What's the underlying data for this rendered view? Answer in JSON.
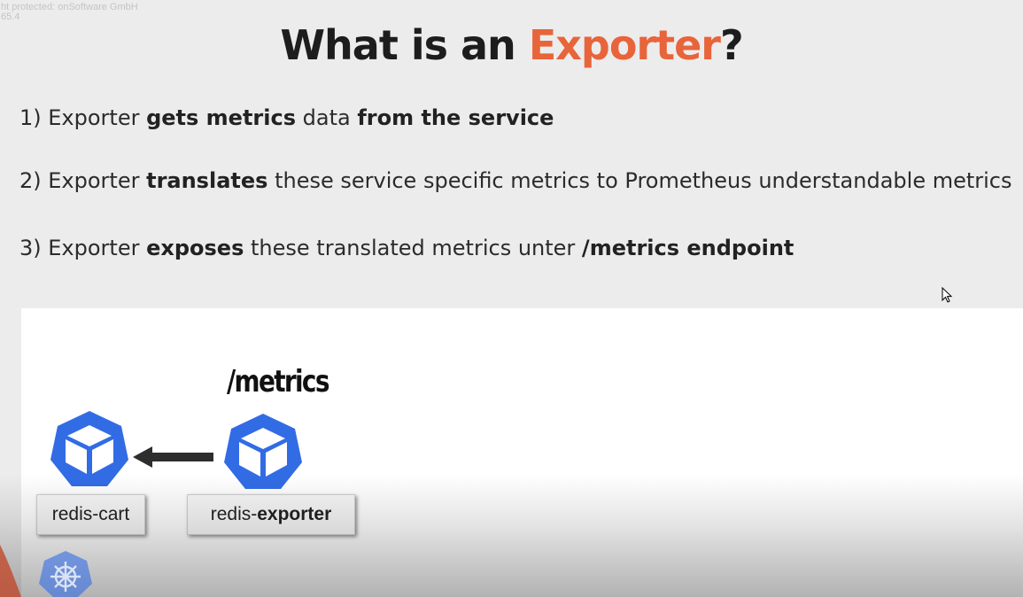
{
  "watermark": {
    "line1": "ht protected: onSoftware GmbH",
    "line2": "65.4"
  },
  "slide": {
    "title_prefix": "What is an ",
    "title_accent": "Exporter",
    "title_suffix": "?",
    "points": [
      {
        "num": "1) ",
        "p1": "Exporter ",
        "b1": "gets metrics",
        "p2": " data ",
        "b2": "from the service"
      },
      {
        "num": "2) ",
        "p1": "Exporter ",
        "b1": "translates",
        "p2": " these service specific metrics to Prometheus understandable metrics"
      },
      {
        "num": "3) ",
        "p1": "Exporter ",
        "b1": "exposes",
        "p2": " these translated metrics unter ",
        "b2": "/metrics endpoint"
      }
    ]
  },
  "diagram": {
    "endpoint_label": "/metrics",
    "pods": [
      {
        "name_plain": "redis-cart",
        "icon": "pod-cube-icon"
      },
      {
        "name_plain": "redis-",
        "name_bold": "exporter",
        "icon": "pod-cube-icon"
      }
    ],
    "arrow_direction": "left",
    "logo_icon": "kubernetes-helm-icon"
  },
  "colors": {
    "accent": "#e8643a",
    "pod_blue": "#326ce5",
    "background": "#ececec",
    "panel": "#ffffff"
  }
}
